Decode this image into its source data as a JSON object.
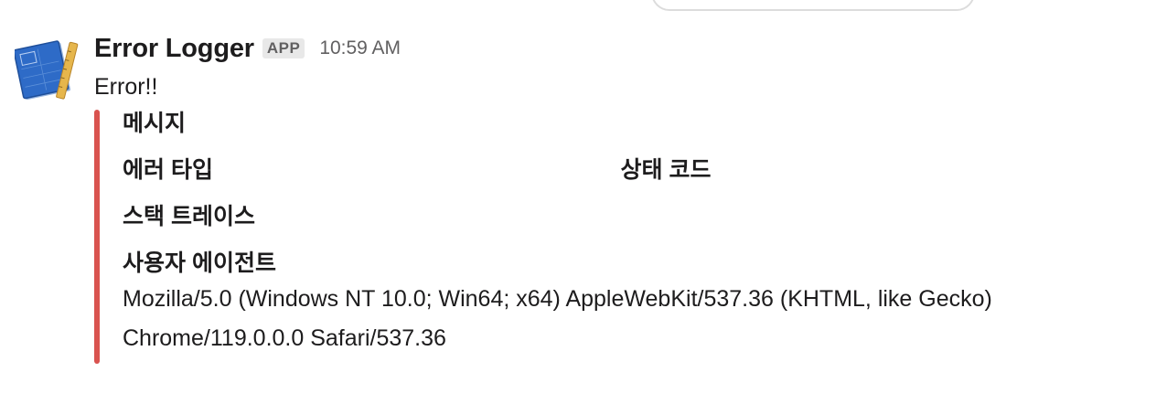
{
  "message": {
    "sender": "Error Logger",
    "badge": "APP",
    "timestamp": "10:59 AM",
    "text": "Error!!",
    "avatar_icon": "blueprint-ruler-icon",
    "attachment": {
      "color": "#d9534f",
      "fields": {
        "message_title": "메시지",
        "error_type_title": "에러 타입",
        "status_code_title": "상태 코드",
        "stack_trace_title": "스택 트레이스",
        "user_agent_title": "사용자 에이전트",
        "user_agent_value": "Mozilla/5.0 (Windows NT 10.0; Win64; x64) AppleWebKit/537.36 (KHTML, like Gecko) Chrome/119.0.0.0 Safari/537.36"
      }
    }
  }
}
